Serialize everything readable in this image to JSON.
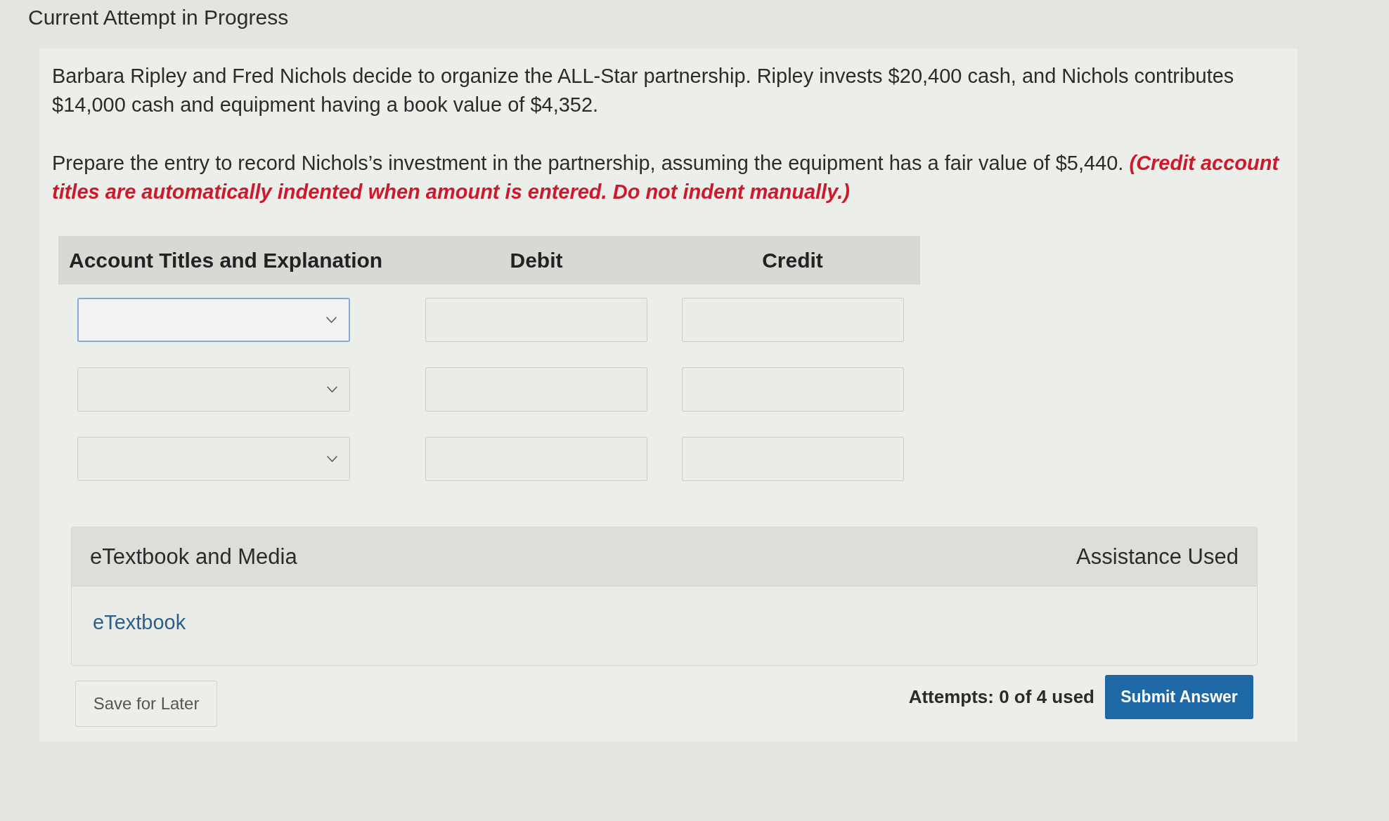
{
  "header": {
    "title": "Current Attempt in Progress"
  },
  "question": {
    "paragraphs": [
      "Barbara Ripley and Fred Nichols decide to organize the ALL-Star partnership. Ripley invests $20,400 cash, and Nichols contributes $14,000 cash and equipment having a book value of $4,352.",
      "Prepare the entry to record Nichols’s investment in the partnership, assuming the equipment has a fair value of $5,440. **(Credit account titles are automatically indented when amount is entered. Do not indent manually.)**"
    ]
  },
  "table": {
    "columns": [
      "Account Titles and Explanation",
      "Debit",
      "Credit"
    ],
    "rows": [
      {
        "focused": true
      },
      {
        "focused": false
      },
      {
        "focused": false
      }
    ]
  },
  "media": {
    "title": "eTextbook and Media",
    "status": "Assistance Used",
    "links": [
      "eTextbook"
    ]
  },
  "footer": {
    "save_button": "Save for Later",
    "attempts": "Attempts: 0 of 4 used",
    "submit_button": "Submit Answer"
  }
}
